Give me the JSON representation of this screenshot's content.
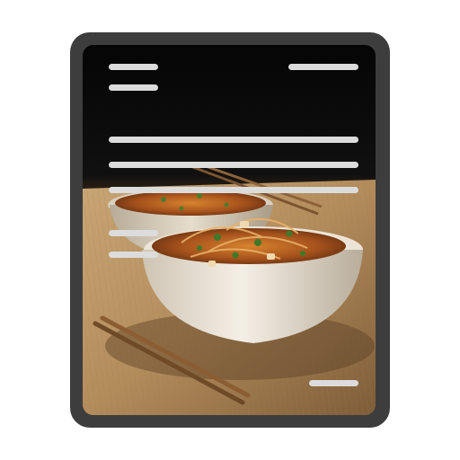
{
  "document_icon": {
    "frame_color": "#3d3d3d",
    "text_line_color": "#dcdcdc",
    "background_photo": "noodle-bowls-on-bamboo-mat"
  }
}
